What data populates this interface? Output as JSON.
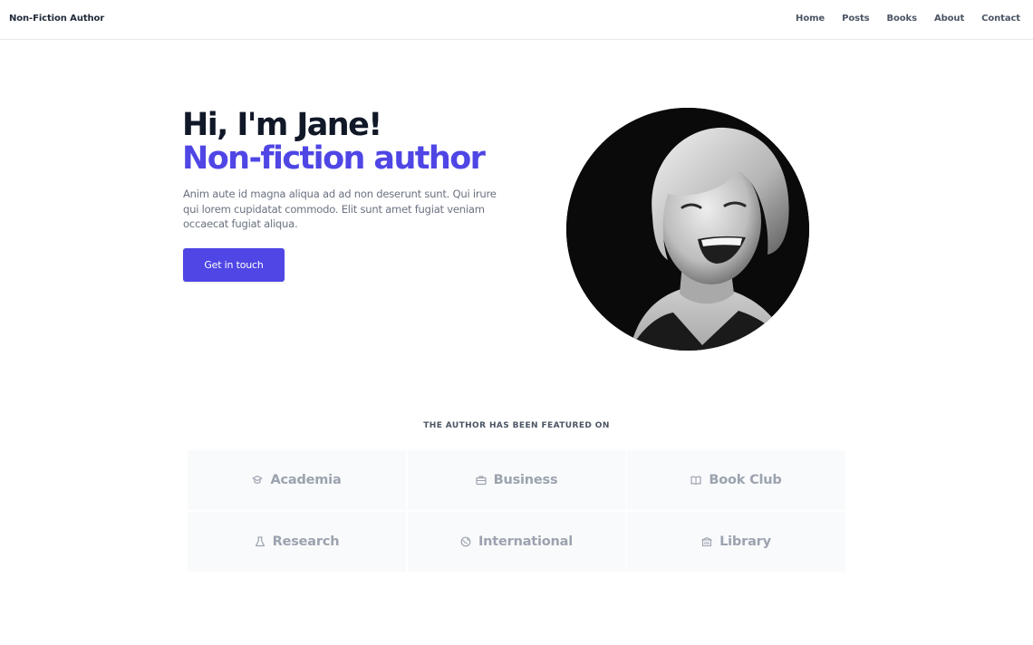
{
  "nav": {
    "brand": "Non-Fiction Author",
    "links": [
      "Home",
      "Posts",
      "Books",
      "About",
      "Contact"
    ]
  },
  "hero": {
    "greeting": "Hi, I'm Jane!",
    "role": "Non-fiction author",
    "description": "Anim aute id magna aliqua ad ad non deserunt sunt. Qui irure qui lorem cupidatat commodo. Elit sunt amet fugiat veniam occaecat fugiat aliqua.",
    "cta_label": "Get in touch",
    "accent_color": "#4f46e5"
  },
  "featured": {
    "heading": "THE AUTHOR HAS BEEN FEATURED ON",
    "items": [
      {
        "label": "Academia",
        "icon": "graduation-cap-icon"
      },
      {
        "label": "Business",
        "icon": "briefcase-icon"
      },
      {
        "label": "Book Club",
        "icon": "open-book-icon"
      },
      {
        "label": "Research",
        "icon": "flask-icon"
      },
      {
        "label": "International",
        "icon": "globe-icon"
      },
      {
        "label": "Library",
        "icon": "building-icon"
      }
    ]
  }
}
